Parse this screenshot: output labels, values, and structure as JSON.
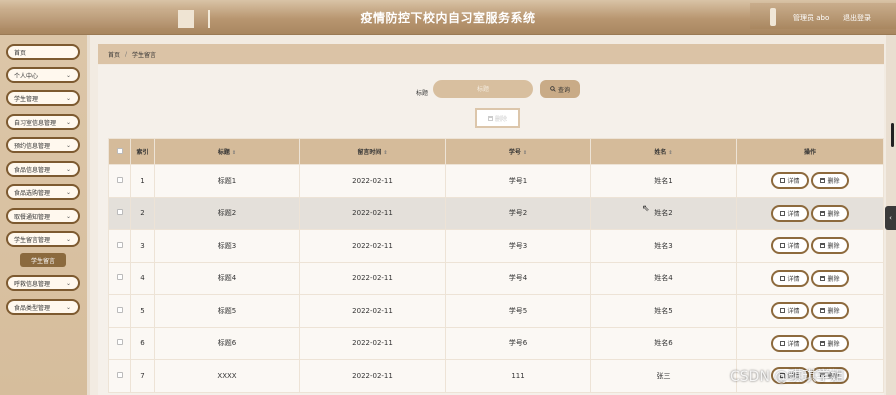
{
  "header": {
    "title": "疫情防控下校内自习室服务系统",
    "user_label": "管理员 abo",
    "logout_label": "退出登录"
  },
  "sidebar": {
    "items": [
      {
        "label": "首页",
        "has_chevron": false
      },
      {
        "label": "个人中心",
        "has_chevron": true
      },
      {
        "label": "学生管理",
        "has_chevron": true
      },
      {
        "label": "自习室信息管理",
        "has_chevron": true
      },
      {
        "label": "预约信息管理",
        "has_chevron": true
      },
      {
        "label": "食品信息管理",
        "has_chevron": true
      },
      {
        "label": "食品选购管理",
        "has_chevron": true
      },
      {
        "label": "取餐通知管理",
        "has_chevron": true
      },
      {
        "label": "学生留言管理",
        "has_chevron": true
      },
      {
        "label": "呼救信息管理",
        "has_chevron": true
      },
      {
        "label": "食品类型管理",
        "has_chevron": true
      }
    ],
    "active_sub": "学生留言",
    "chevron": "⌄"
  },
  "breadcrumb": {
    "home": "首页",
    "separator": "/",
    "current": "学生留言"
  },
  "search": {
    "label": "标题",
    "placeholder": "标题",
    "button_label": "查询"
  },
  "toolbar": {
    "delete_label": "删除"
  },
  "table": {
    "columns": [
      "",
      "索引",
      "标题",
      "留言时间",
      "学号",
      "姓名",
      "操作"
    ],
    "sortable": [
      false,
      false,
      true,
      true,
      true,
      true,
      false
    ],
    "sort_glyph": "⇕",
    "rows": [
      {
        "index": "1",
        "title": "标题1",
        "time": "2022-02-11",
        "id": "学号1",
        "name": "姓名1"
      },
      {
        "index": "2",
        "title": "标题2",
        "time": "2022-02-11",
        "id": "学号2",
        "name": "姓名2"
      },
      {
        "index": "3",
        "title": "标题3",
        "time": "2022-02-11",
        "id": "学号3",
        "name": "姓名3"
      },
      {
        "index": "4",
        "title": "标题4",
        "time": "2022-02-11",
        "id": "学号4",
        "name": "姓名4"
      },
      {
        "index": "5",
        "title": "标题5",
        "time": "2022-02-11",
        "id": "学号5",
        "name": "姓名5"
      },
      {
        "index": "6",
        "title": "标题6",
        "time": "2022-02-11",
        "id": "学号6",
        "name": "姓名6"
      },
      {
        "index": "7",
        "title": "XXXX",
        "time": "2022-02-11",
        "id": "111",
        "name": "张三"
      }
    ],
    "detail_label": "详情",
    "delete_label": "删除"
  },
  "watermark": "CSDN @琪琪学姐",
  "icons": {
    "search": "search-icon",
    "delete": "trash-icon",
    "detail": "detail-icon",
    "cursor": "mouse-cursor-icon",
    "collapse": "chevron-left-icon"
  },
  "colors": {
    "accent": "#8b6a3e",
    "header_bg": "#b89670",
    "table_header": "#d5bb9a"
  }
}
